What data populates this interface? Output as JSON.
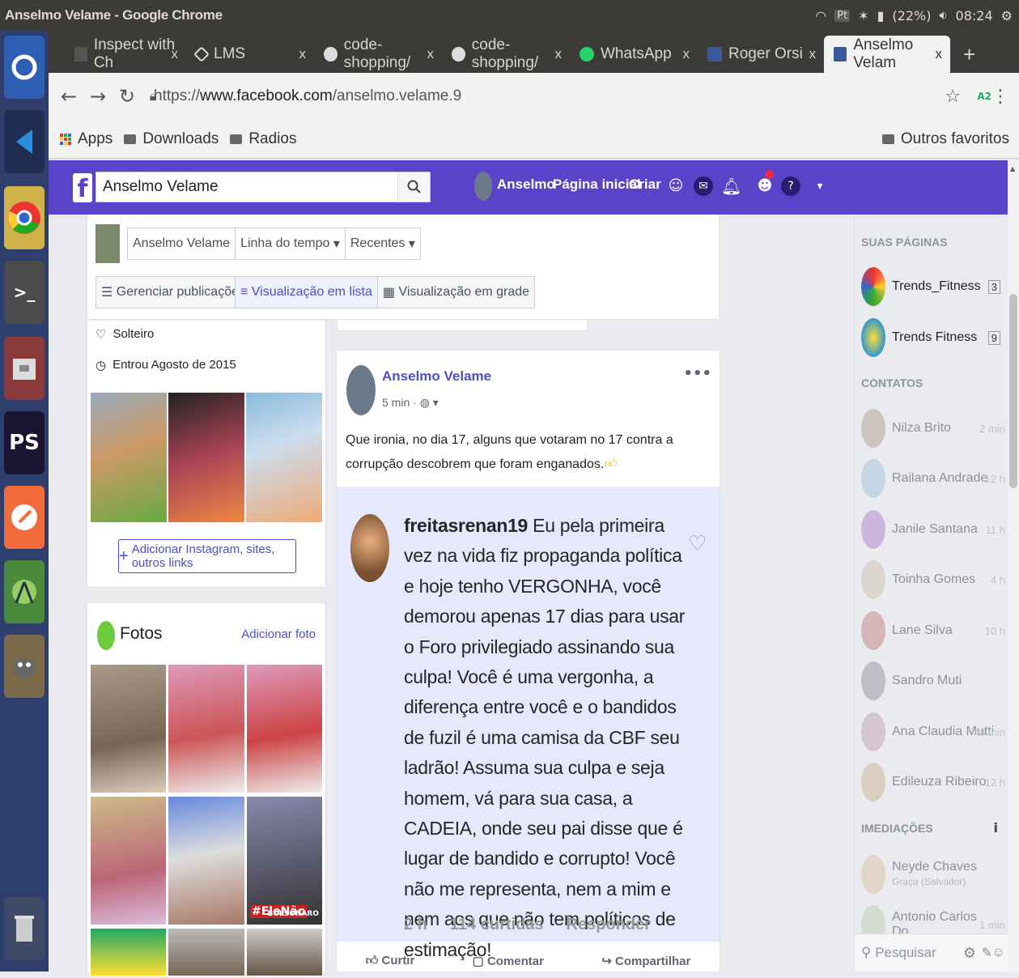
{
  "os": {
    "window_title": "Anselmo Velame - Google Chrome",
    "battery": "(22%)",
    "time": "08:24",
    "input_badge": "Pt"
  },
  "tabs": [
    {
      "label": "Inspect with Ch"
    },
    {
      "label": "LMS"
    },
    {
      "label": "code-shopping/"
    },
    {
      "label": "code-shopping/"
    },
    {
      "label": "WhatsApp"
    },
    {
      "label": "Roger Orsi"
    },
    {
      "label": "Anselmo Velam"
    }
  ],
  "address": {
    "scheme": "https://",
    "host": "www.facebook.com",
    "path": "/anselmo.velame.9"
  },
  "bookmarks": {
    "apps": "Apps",
    "downloads": "Downloads",
    "radios": "Radios",
    "others": "Outros favoritos"
  },
  "fb_header": {
    "search_value": "Anselmo Velame",
    "profile_name": "Anselmo",
    "home": "Página inicial",
    "create": "Criar"
  },
  "profile_bar": {
    "name_btn": "Anselmo Velame",
    "timeline_btn": "Linha do tempo",
    "recent_btn": "Recentes",
    "manage_btn": "Gerenciar publicações",
    "list_view_btn": "Visualização em lista",
    "grid_view_btn": "Visualização em grade"
  },
  "intro": {
    "status": "Solteiro",
    "joined": "Entrou Agosto de 2015",
    "add_links": "Adicionar Instagram, sites, outros links"
  },
  "photos": {
    "title": "Fotos",
    "add_photo": "Adicionar foto",
    "elenao": "#EleNão",
    "bolsonaro": "BOLSONARO"
  },
  "post": {
    "author": "Anselmo Velame",
    "time": "5 min ·",
    "text": "Que ironia, no dia 17, alguns que votaram no 17 contra a corrupção descobrem que foram enganados.",
    "comment_user": "freitasrenan19",
    "comment_text": "Eu pela primeira vez na vida fiz propaganda política e hoje tenho VERGONHA, você demorou apenas 17 dias para usar o Foro privilegiado assinando sua culpa! Você é uma vergonha, a diferença entre você e o bandidos de fuzil é uma camisa da CBF seu ladrão! Assuma sua culpa e seja homem, vá para sua casa, a CADEIA, onde seu pai disse que é lugar de bandido e corrupto! Você não me representa, nem a mim e nem aos que não tem políticos de estimação!",
    "comment_time": "2 h",
    "comment_likes": "114 curtidas",
    "comment_reply": "Responder",
    "like": "Curtir",
    "comment": "Comentar",
    "share": "Compartilhar"
  },
  "sidebar": {
    "pages_header": "SUAS PÁGINAS",
    "pages": [
      {
        "name": "Trends_Fitness",
        "count": "3"
      },
      {
        "name": "Trends Fitness",
        "count": "9"
      }
    ],
    "contacts_header": "CONTATOS",
    "contacts": [
      {
        "name": "Nilza Brito",
        "time": "2 min"
      },
      {
        "name": "Railana Andrade",
        "time": "12 h"
      },
      {
        "name": "Janile Santana",
        "time": "11 h"
      },
      {
        "name": "Toinha Gomes",
        "time": "4 h"
      },
      {
        "name": "Lane Silva",
        "time": "10 h"
      },
      {
        "name": "Sandro Muti",
        "time": ""
      },
      {
        "name": "Ana Claudia Mutti",
        "time": "48 min"
      },
      {
        "name": "Edileuza Ribeiro",
        "time": "12 h"
      }
    ],
    "nearby_header": "IMEDIAÇÕES",
    "nearby": [
      {
        "name": "Neyde Chaves",
        "sub": "Graça (Salvador)",
        "time": ""
      },
      {
        "name": "Antonio Carlos Do...",
        "sub": "",
        "time": "1 min"
      }
    ],
    "search_placeholder": "Pesquisar"
  }
}
